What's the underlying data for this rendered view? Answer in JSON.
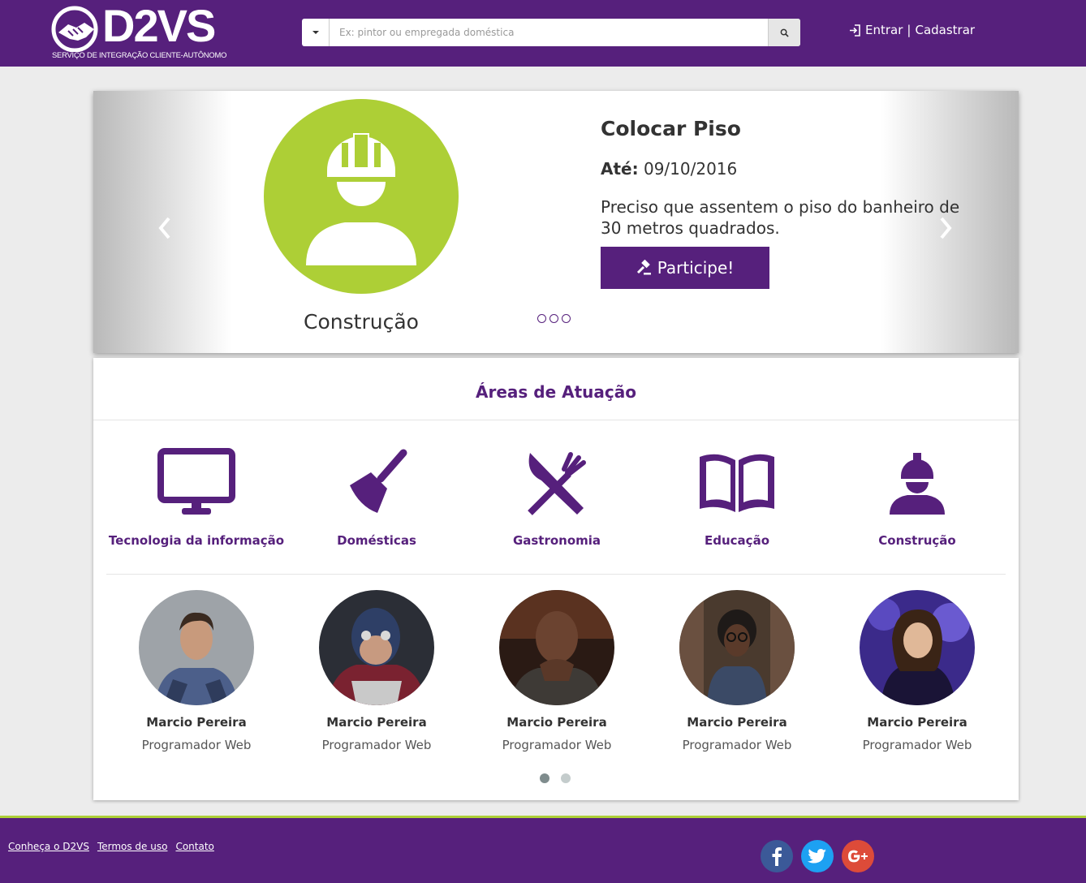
{
  "header": {
    "logo_text": "D2VS",
    "logo_subtitle": "SERVIÇO DE INTEGRAÇÃO CLIENTE-AUTÔNOMO",
    "search_placeholder": "Ex: pintor ou empregada doméstica",
    "login_label": "Entrar",
    "separator": "|",
    "register_label": "Cadastrar"
  },
  "carousel": {
    "category": "Construção",
    "title": "Colocar Piso",
    "date_label": "Até:",
    "date_value": "09/10/2016",
    "description": "Preciso que assentem o piso do banheiro de 30 metros quadrados.",
    "cta_label": "Participe!",
    "slide_count": 3,
    "circle_color": "#adcf36"
  },
  "areas": {
    "title": "Áreas de Atuação",
    "items": [
      {
        "label": "Tecnologia da informação",
        "icon": "monitor-icon"
      },
      {
        "label": "Domésticas",
        "icon": "broom-icon"
      },
      {
        "label": "Gastronomia",
        "icon": "fork-knife-icon"
      },
      {
        "label": "Educação",
        "icon": "book-icon"
      },
      {
        "label": "Construção",
        "icon": "worker-icon"
      }
    ]
  },
  "people": [
    {
      "name": "Marcio Pereira",
      "role": "Programador Web"
    },
    {
      "name": "Marcio Pereira",
      "role": "Programador Web"
    },
    {
      "name": "Marcio Pereira",
      "role": "Programador Web"
    },
    {
      "name": "Marcio Pereira",
      "role": "Programador Web"
    },
    {
      "name": "Marcio Pereira",
      "role": "Programador Web"
    }
  ],
  "people_pages": 2,
  "footer": {
    "links": [
      "Conheça o D2VS",
      "Termos de uso",
      "Contato"
    ],
    "social": [
      "facebook-icon",
      "twitter-icon",
      "google-plus-icon"
    ]
  },
  "colors": {
    "brand_purple": "#56207c",
    "accent_green": "#adcf36",
    "facebook": "#3b5998",
    "twitter": "#1da1f2",
    "google_plus": "#dd4b39"
  }
}
